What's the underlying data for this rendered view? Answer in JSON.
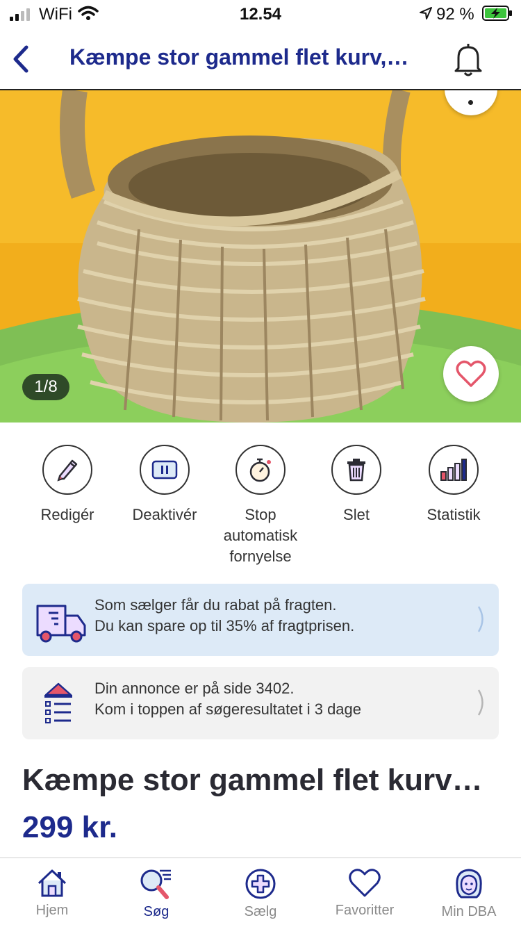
{
  "status_bar": {
    "carrier": "WiFi",
    "time": "12.54",
    "battery": "92 %"
  },
  "nav": {
    "title": "Kæmpe stor gammel flet kurv,…"
  },
  "photo": {
    "counter": "1/8",
    "favorite_icon": "heart-outline"
  },
  "actions": [
    {
      "label": "Redigér",
      "icon": "pencil"
    },
    {
      "label": "Deaktivér",
      "icon": "pause"
    },
    {
      "label": "Stop automatisk fornyelse",
      "icon": "stopwatch"
    },
    {
      "label": "Slet",
      "icon": "trash"
    },
    {
      "label": "Statistik",
      "icon": "bar-chart"
    }
  ],
  "cards": {
    "shipping": {
      "line1": "Som sælger får du rabat på fragten.",
      "line2": "Du kan spare op til 35% af fragtprisen."
    },
    "position": {
      "line1": "Din annonce er på side 3402.",
      "line2": "Kom i toppen af søgeresultatet i 3 dage"
    }
  },
  "listing": {
    "title": "Kæmpe stor gammel flet kurv…",
    "price": "299 kr."
  },
  "tabs": [
    {
      "label": "Hjem",
      "active": false
    },
    {
      "label": "Søg",
      "active": true
    },
    {
      "label": "Sælg",
      "active": false
    },
    {
      "label": "Favoritter",
      "active": false
    },
    {
      "label": "Min DBA",
      "active": false
    }
  ],
  "colors": {
    "brand_blue": "#1d2a8c",
    "card_blue": "#ddeaf7",
    "accent_red": "#e4566a"
  }
}
